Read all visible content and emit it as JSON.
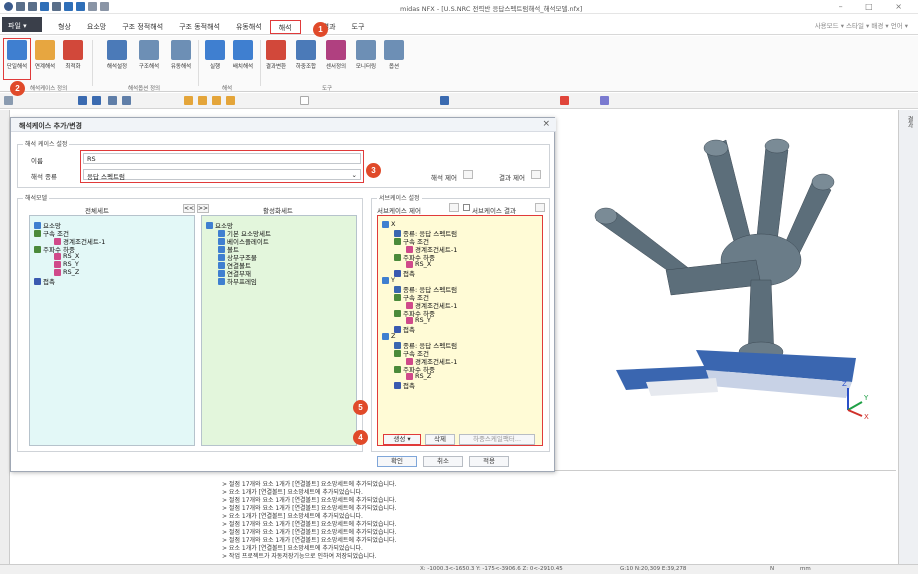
{
  "titlebar": {
    "title": "midas NFX - [U.S.NRC 전력반 응답스펙트럼해석_해석모델.nfx]",
    "window_controls": "–  □  ×"
  },
  "menubar": {
    "app_label": "파일",
    "tabs": [
      "형상",
      "요소망",
      "구조 정적해석",
      "구조 동적해석",
      "유동해석",
      "해석",
      "결과",
      "도구"
    ],
    "active_tab": "해석",
    "right_text": "사용모드 ▾ 스타일 ▾ 배경 ▾ 언어 ▾"
  },
  "ribbon": {
    "buttons": [
      "단일해석",
      "연계해석",
      "최적화",
      "해석설정",
      "구조해석",
      "유동해석",
      "실행",
      "배치해석",
      "결과변환",
      "하중조합",
      "센서정의",
      "모니터링",
      "옵션"
    ],
    "groups": [
      "해석케이스 정의",
      "해석옵션 정의",
      "해석",
      "도구"
    ]
  },
  "dialog": {
    "title": "해석케이스 추가/변경",
    "close": "×",
    "case_settings_label": "해석 케이스 설정",
    "name_label": "이름",
    "name_value": "RS",
    "type_label": "해석 종류",
    "type_value": "응답 스펙트럼",
    "analysis_control": "해석 제어",
    "result_control": "결과 제어",
    "model_label": "해석모델",
    "all_set_label": "전체세트",
    "active_set_label": "활성화세트",
    "move_left": "<<",
    "move_right": ">>",
    "left_tree": [
      "요소망",
      "구속 조건",
      "경계조건세트-1",
      "주파수 하중",
      "RS_X",
      "RS_Y",
      "RS_Z",
      "접촉"
    ],
    "middle_tree": [
      "요소망",
      "기본 요소망세트",
      "베이스플레이트",
      "볼트",
      "상부구조물",
      "연결볼트",
      "연결부재",
      "하부프레임"
    ],
    "subcase_settings_label": "서브케이스 설정",
    "subcase_control": "서브케이스 제어",
    "subcase_result": "서브케이스 결과",
    "right_tree": [
      "X",
      "종류: 응답 스펙트럼",
      "구속 조건",
      "경계조건세트-1",
      "주파수 하중",
      "RS_X",
      "접촉",
      "Y",
      "종류: 응답 스펙트럼",
      "구속 조건",
      "경계조건세트-1",
      "주파수 하중",
      "RS_Y",
      "접촉",
      "Z",
      "종류: 응답 스펙트럼",
      "구속 조건",
      "경계조건세트-1",
      "주파수 하중",
      "RS_Z",
      "접촉"
    ],
    "create_btn": "생성",
    "delete_btn": "삭제",
    "load_combo_btn": "하중스케일팩터...",
    "ok_btn": "확인",
    "cancel_btn": "취소",
    "apply_btn": "적용"
  },
  "right_panel_label": "결과",
  "output_lines": [
    "> 절점 17개와 요소 1개가 [연결볼트] 요소망세트에 추가되었습니다.",
    "> 요소 1개가 [연결볼트] 요소망세트에 추가되었습니다.",
    "> 절점 17개와 요소 1개가 [연결볼트] 요소망세트에 추가되었습니다.",
    "> 절점 17개와 요소 1개가 [연결볼트] 요소망세트에 추가되었습니다.",
    "> 요소 1개가 [연결볼트] 요소망세트에 추가되었습니다.",
    "> 절점 17개와 요소 1개가 [연결볼트] 요소망세트에 추가되었습니다.",
    "> 절점 17개와 요소 1개가 [연결볼트] 요소망세트에 추가되었습니다.",
    "> 절점 17개와 요소 1개가 [연결볼트] 요소망세트에 추가되었습니다.",
    "> 요소 1개가 [연결볼트] 요소망세트에 추가되었습니다.",
    "> 작업 프로젝트가 자동저장기능으로 인하여 저장되었습니다."
  ],
  "statusbar": {
    "coords": "X: -1000.3<-1650.3 Y: -175<-3906.6 Z: 0<-2910.45",
    "grid": "G:10 N:20,309 E:39,278",
    "unit": "N",
    "length": "mm"
  },
  "badges": [
    "1",
    "2",
    "3",
    "4",
    "5"
  ],
  "axis_labels": [
    "Z",
    "Y",
    "X"
  ],
  "colors": {
    "accent_red": "#e03a3a",
    "badge": "#e04a2a",
    "tree_cyan": "#e3f8f7",
    "tree_green": "#e3f6dc",
    "tree_yellow": "#fffbd6",
    "model_gray": "#5c6e7a"
  }
}
